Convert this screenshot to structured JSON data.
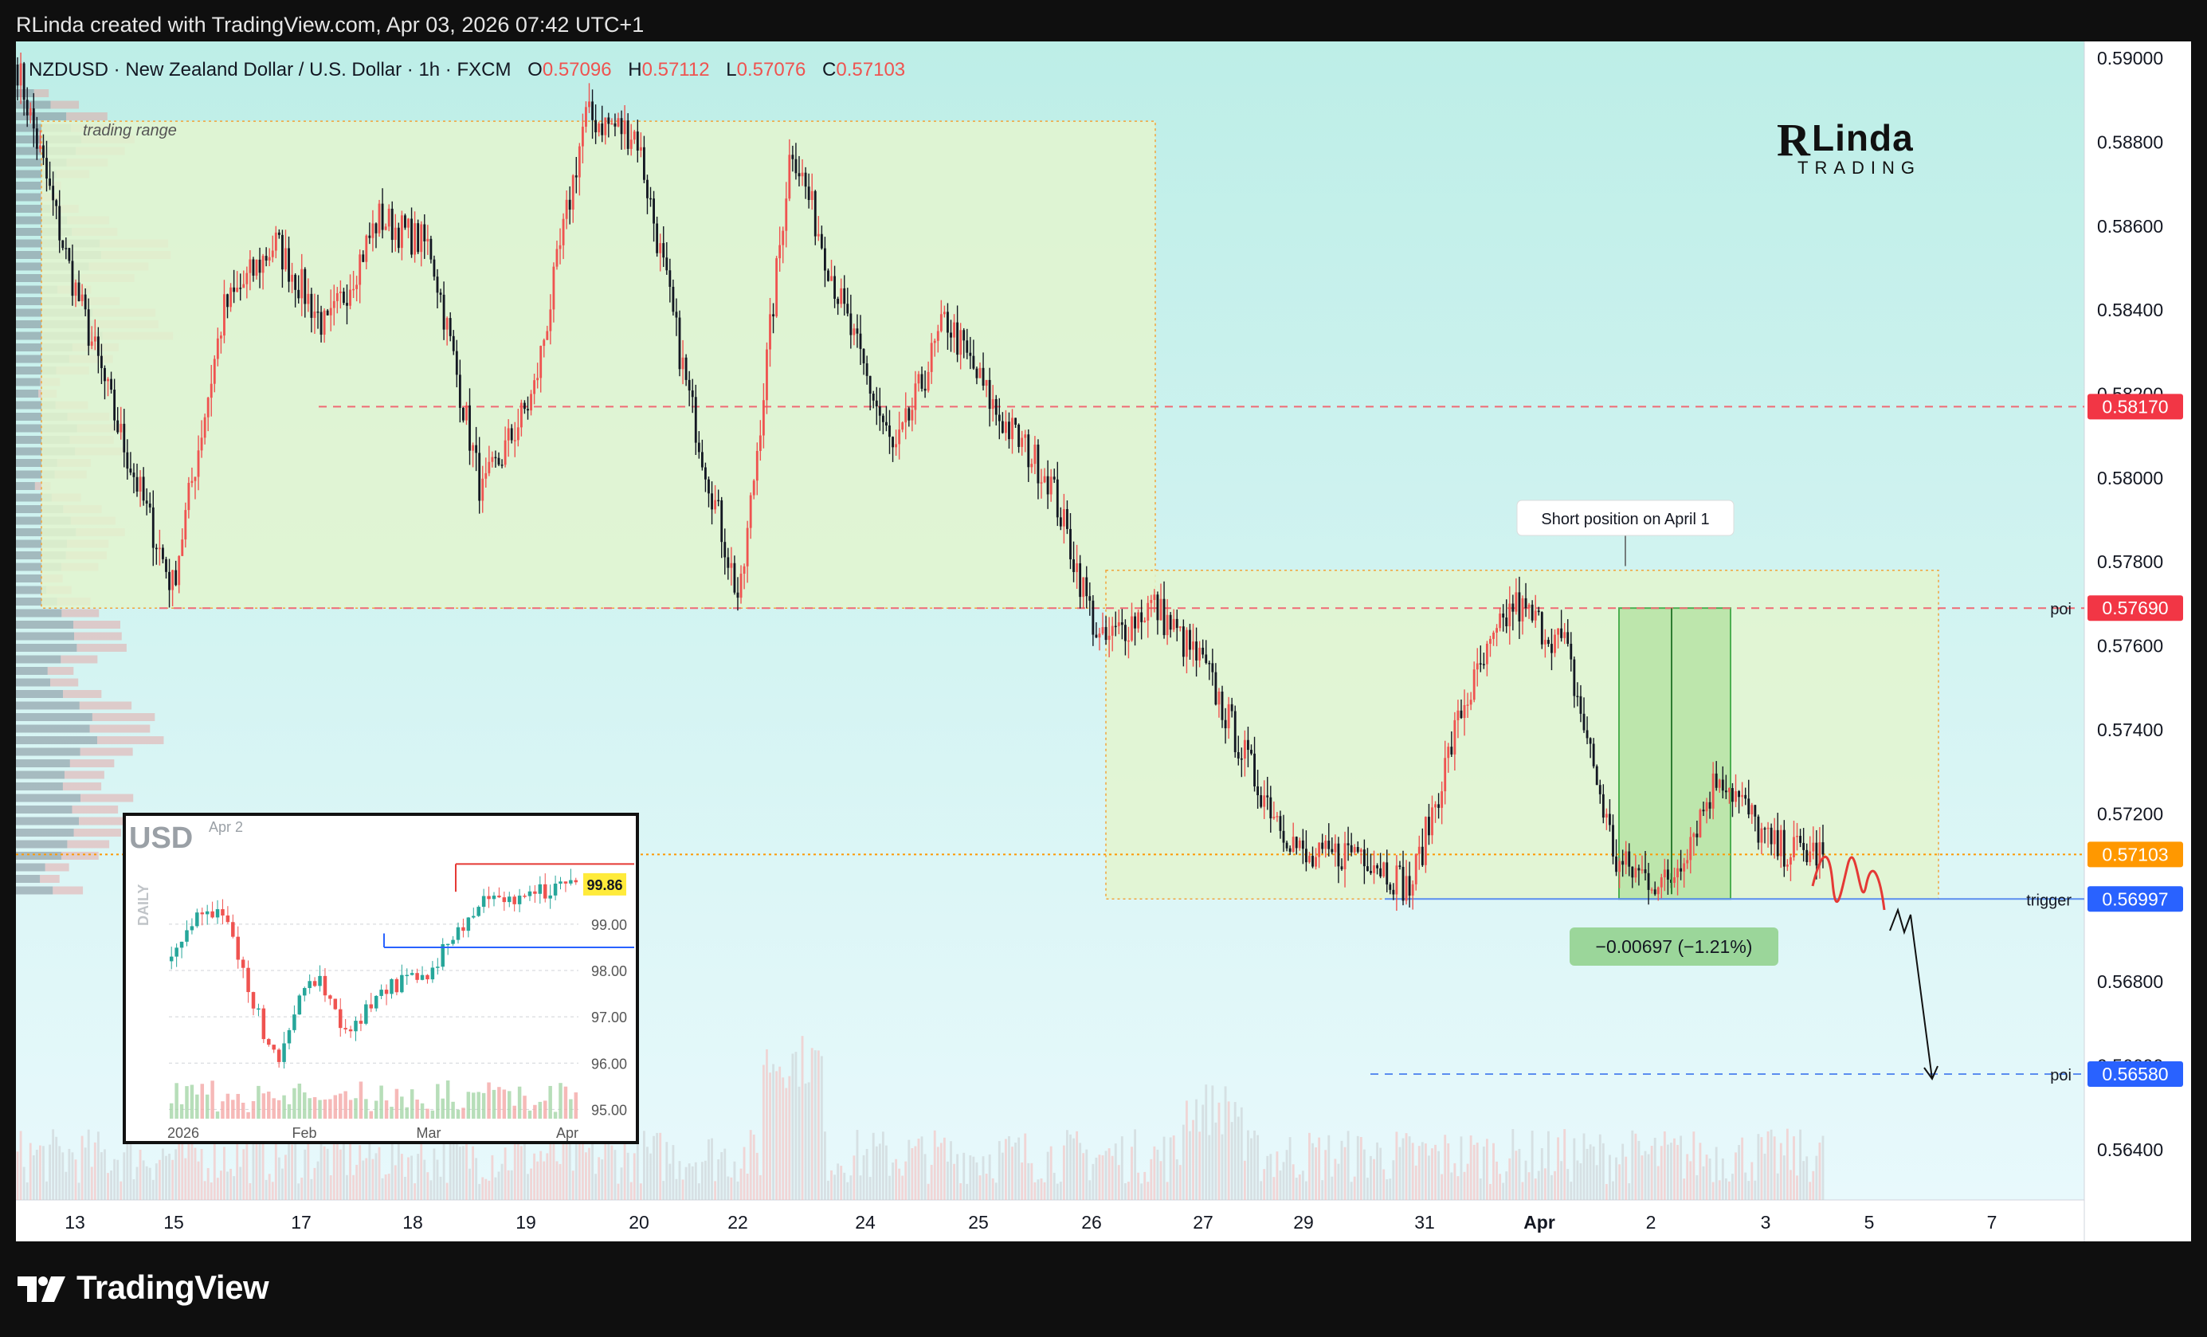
{
  "header": {
    "credit": "RLinda created with TradingView.com, Apr 03, 2026 07:42 UTC+1"
  },
  "symbol": {
    "title": "NZDUSD · New Zealand Dollar / U.S. Dollar · 1h · FXCM",
    "o_label": "O",
    "o": "0.57096",
    "h_label": "H",
    "h": "0.57112",
    "l_label": "L",
    "l": "0.57076",
    "c_label": "C",
    "c": "0.57103"
  },
  "logo": {
    "r": "R",
    "main": "Linda",
    "sub": "TRADING"
  },
  "colors": {
    "up": "#ef5350",
    "down": "#131722",
    "bg_top": "#c8f0ea",
    "bg_bottom": "#e4f7fb",
    "zone": "#e3f5cf",
    "zone_border": "#f2a33a",
    "tp_zone": "#b6e3a5",
    "badge_red": "#f23645",
    "badge_blue": "#2962ff",
    "badge_orange": "#ff9800"
  },
  "annotations": {
    "trading_range": "trading range",
    "short_position": "Short position on April 1",
    "poi": "poi",
    "trigger": "trigger",
    "measure": "−0.00697 (−1.21%)"
  },
  "price_axis": {
    "ticks": [
      "0.59000",
      "0.58800",
      "0.58600",
      "0.58400",
      "0.58200",
      "0.58000",
      "0.57800",
      "0.57600",
      "0.57400",
      "0.57200",
      "0.57000",
      "0.56800",
      "0.56600",
      "0.56400"
    ],
    "badges": [
      {
        "label": "0.58170",
        "price": 0.5817,
        "color": "#f23645"
      },
      {
        "label": "0.57690",
        "price": 0.5769,
        "color": "#f23645"
      },
      {
        "label": "0.57103",
        "price": 0.57103,
        "color": "#ff9800"
      },
      {
        "label": "0.56997",
        "price": 0.56997,
        "color": "#2962ff"
      },
      {
        "label": "0.56580",
        "price": 0.5658,
        "color": "#2962ff"
      }
    ]
  },
  "time_axis": {
    "labels": [
      "13",
      "15",
      "17",
      "18",
      "19",
      "20",
      "22",
      "24",
      "25",
      "26",
      "27",
      "29",
      "31",
      "Apr",
      "2",
      "3",
      "5",
      "7"
    ]
  },
  "inset": {
    "title": "USD",
    "date": "Apr 2",
    "side_label": "DAILY",
    "price_badge": "99.86",
    "yticks": [
      "99.00",
      "98.00",
      "97.00",
      "96.00",
      "95.00"
    ],
    "xticks": [
      "2026",
      "Feb",
      "Mar",
      "Apr"
    ]
  },
  "footer": {
    "brand": "TradingView"
  },
  "chart_data": {
    "type": "candlestick",
    "title": "NZDUSD · New Zealand Dollar / U.S. Dollar · 1h · FXCM",
    "ylim": [
      0.5628,
      0.5904
    ],
    "y_scale": "linear",
    "grid": false,
    "last_price": 0.57103,
    "ohlc_last": {
      "open": 0.57096,
      "high": 0.57112,
      "low": 0.57076,
      "close": 0.57103
    },
    "path_keypoints": [
      {
        "x": "Mar 12",
        "price": 0.5898
      },
      {
        "x": "Mar 13",
        "price": 0.585
      },
      {
        "x": "Mar 14",
        "price": 0.581
      },
      {
        "x": "Mar 15",
        "price": 0.5774
      },
      {
        "x": "Mar 16",
        "price": 0.584
      },
      {
        "x": "Mar 17",
        "price": 0.5856
      },
      {
        "x": "Mar 17b",
        "price": 0.5835
      },
      {
        "x": "Mar 18",
        "price": 0.5862
      },
      {
        "x": "Mar 18b",
        "price": 0.5855
      },
      {
        "x": "Mar 19",
        "price": 0.5796
      },
      {
        "x": "Mar 19b",
        "price": 0.582
      },
      {
        "x": "Mar 20",
        "price": 0.5886
      },
      {
        "x": "Mar 21",
        "price": 0.5882
      },
      {
        "x": "Mar 22",
        "price": 0.582
      },
      {
        "x": "Mar 23",
        "price": 0.577
      },
      {
        "x": "Mar 23b",
        "price": 0.588
      },
      {
        "x": "Mar 24",
        "price": 0.584
      },
      {
        "x": "Mar 24b",
        "price": 0.5805
      },
      {
        "x": "Mar 25",
        "price": 0.5838
      },
      {
        "x": "Mar 25b",
        "price": 0.5815
      },
      {
        "x": "Mar 26",
        "price": 0.58
      },
      {
        "x": "Mar 27",
        "price": 0.576
      },
      {
        "x": "Mar 27b",
        "price": 0.577
      },
      {
        "x": "Mar 28",
        "price": 0.5755
      },
      {
        "x": "Mar 29",
        "price": 0.5728
      },
      {
        "x": "Mar 30",
        "price": 0.5708
      },
      {
        "x": "Mar 31",
        "price": 0.5712
      },
      {
        "x": "Mar 31b",
        "price": 0.5702
      },
      {
        "x": "Apr 1",
        "price": 0.5745
      },
      {
        "x": "Apr 1b",
        "price": 0.577
      },
      {
        "x": "Apr 1c",
        "price": 0.576
      },
      {
        "x": "Apr 2",
        "price": 0.5708
      },
      {
        "x": "Apr 2b",
        "price": 0.5703
      },
      {
        "x": "Apr 2c",
        "price": 0.573
      },
      {
        "x": "Apr 3",
        "price": 0.5712
      },
      {
        "x": "Apr 3b",
        "price": 0.57103
      }
    ],
    "levels": [
      {
        "name": "0.58170",
        "price": 0.5817,
        "style": "dashed"
      },
      {
        "name": "poi",
        "price": 0.5769,
        "style": "dashed"
      },
      {
        "name": "trigger",
        "price": 0.56997,
        "style": "solid"
      },
      {
        "name": "poi",
        "price": 0.5658,
        "style": "dashed"
      }
    ],
    "zones": [
      {
        "name": "trading range",
        "from": "Mar 12",
        "to": "Mar 26",
        "top": 0.5885,
        "bottom": 0.5769
      },
      {
        "name": "",
        "from": "Mar 26",
        "to": "Apr 6",
        "top": 0.5778,
        "bottom": 0.56997
      }
    ],
    "measure": {
      "label": "−0.00697 (−1.21%)",
      "from": 0.5769,
      "to": 0.56997
    }
  }
}
